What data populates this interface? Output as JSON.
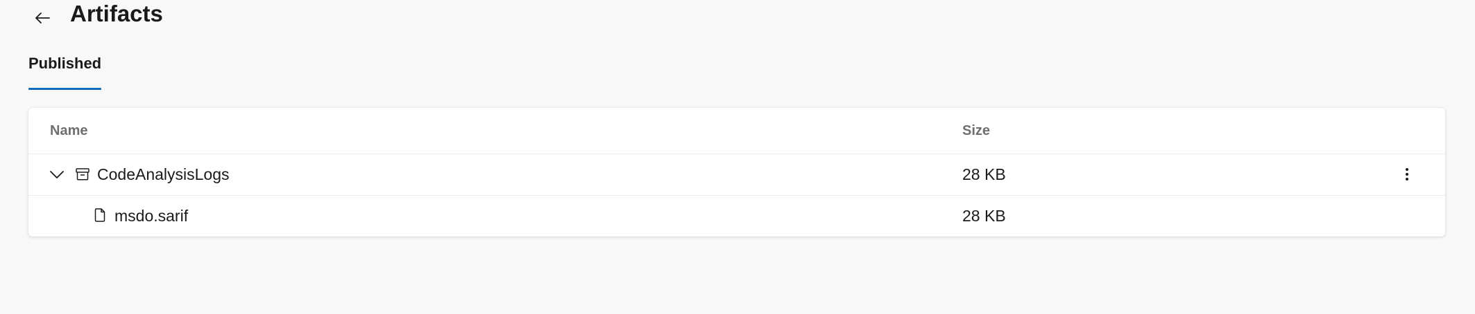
{
  "page": {
    "title": "Artifacts",
    "back_icon": "arrow-left-icon"
  },
  "tabs": [
    {
      "label": "Published",
      "selected": true
    }
  ],
  "colors": {
    "accent": "#0f6cbd",
    "background": "#f8f8f8",
    "card": "#ffffff"
  },
  "table": {
    "columns": {
      "name": "Name",
      "size": "Size"
    },
    "rows": [
      {
        "name": "CodeAnalysisLogs",
        "size": "28 KB",
        "expanded": true,
        "icon": "archive-box-icon",
        "expander_icon": "chevron-down-icon",
        "more_icon": "more-vertical-icon"
      },
      {
        "name": "msdo.sarif",
        "size": "28 KB",
        "icon": "file-icon"
      }
    ]
  }
}
